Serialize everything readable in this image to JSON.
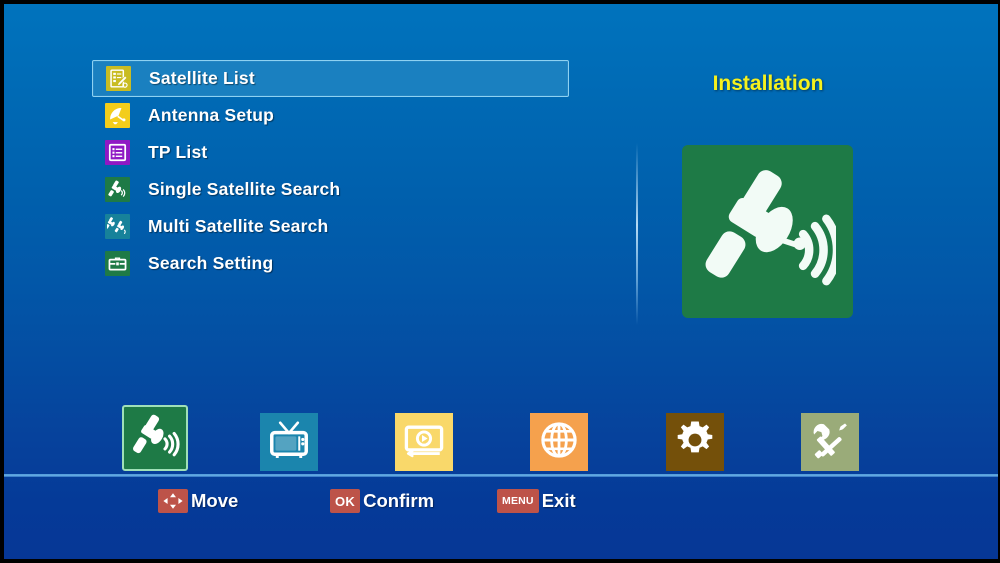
{
  "screen": {
    "title": "Installation",
    "background_top_color": "#0073bd",
    "background_bottom_color": "#063796",
    "highlight_color": "#1a80c0",
    "highlight_border_color": "#8ed2f2",
    "title_color": "#f5f11e"
  },
  "menu": {
    "items": [
      {
        "label": "Satellite List",
        "icon": "satellite-list-icon",
        "icon_bg": "#c9bc22",
        "selected": true
      },
      {
        "label": "Antenna Setup",
        "icon": "satellite-dish-icon",
        "icon_bg": "#f3cd1b",
        "selected": false
      },
      {
        "label": "TP List",
        "icon": "list-lines-icon",
        "icon_bg": "#8f18c4",
        "selected": false
      },
      {
        "label": "Single Satellite Search",
        "icon": "satellite-signal-icon",
        "icon_bg": "#1e7a46",
        "selected": false
      },
      {
        "label": "Multi Satellite Search",
        "icon": "multi-satellite-icon",
        "icon_bg": "#17829a",
        "selected": false
      },
      {
        "label": "Search Setting",
        "icon": "toolbox-icon",
        "icon_bg": "#1e7a46",
        "selected": false
      }
    ]
  },
  "preview": {
    "icon": "satellite-dish-signal-icon",
    "bg_color": "#1e7a46"
  },
  "icon_strip": {
    "items": [
      {
        "name": "installation",
        "icon": "satellite-signal-icon",
        "bg": "#1e7a46",
        "selected": true
      },
      {
        "name": "channel",
        "icon": "television-icon",
        "bg": "#1b85ad",
        "selected": false
      },
      {
        "name": "media",
        "icon": "media-player-icon",
        "bg": "#f9d86a",
        "selected": false
      },
      {
        "name": "network",
        "icon": "globe-icon",
        "bg": "#f5a14d",
        "selected": false
      },
      {
        "name": "system-setup",
        "icon": "gear-icon",
        "bg": "#74500a",
        "selected": false
      },
      {
        "name": "tools",
        "icon": "wrench-screwdriver-icon",
        "bg": "#9aab79",
        "selected": false
      }
    ]
  },
  "footer": {
    "hints": [
      {
        "key": "dpad",
        "key_text": "",
        "label": "Move"
      },
      {
        "key": "ok",
        "key_text": "OK",
        "label": "Confirm"
      },
      {
        "key": "menu",
        "key_text": "MENU",
        "label": "Exit"
      }
    ],
    "badge_color": "#bd5349"
  }
}
